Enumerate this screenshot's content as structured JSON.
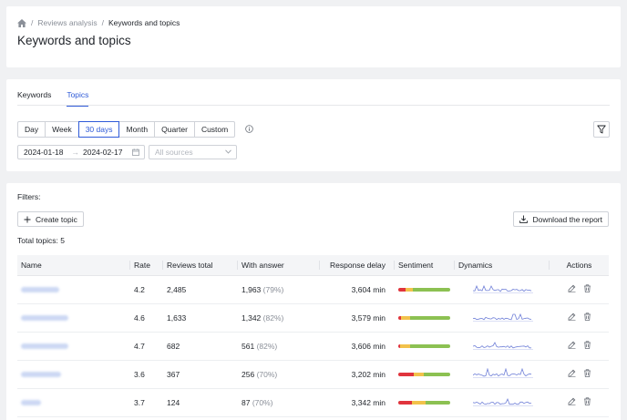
{
  "breadcrumb": {
    "section": "Reviews analysis",
    "current": "Keywords and topics"
  },
  "page_title": "Keywords and topics",
  "tabs": [
    {
      "label": "Keywords",
      "active": false
    },
    {
      "label": "Topics",
      "active": true
    }
  ],
  "period": {
    "options": [
      "Day",
      "Week",
      "30 days",
      "Month",
      "Quarter",
      "Custom"
    ],
    "selected": "30 days"
  },
  "daterange": {
    "from": "2024-01-18",
    "to": "2024-02-17",
    "separator": "→"
  },
  "sources": {
    "placeholder": "All sources"
  },
  "filters_label": "Filters:",
  "create_topic_label": "Create topic",
  "download_label": "Download the report",
  "total_topics": "Total topics: 5",
  "table": {
    "columns": {
      "name": "Name",
      "rate": "Rate",
      "reviews_total": "Reviews total",
      "with_answer": "With answer",
      "response_delay": "Response delay",
      "sentiment": "Sentiment",
      "dynamics": "Dynamics",
      "actions": "Actions"
    },
    "rows": [
      {
        "rate": "4.2",
        "reviews_total": "2,485",
        "with_answer": "1,963",
        "with_answer_pct": "(79%)",
        "response_delay": "3,604 min",
        "sentiment": [
          0.14,
          0.14,
          0.72
        ]
      },
      {
        "rate": "4.6",
        "reviews_total": "1,633",
        "with_answer": "1,342",
        "with_answer_pct": "(82%)",
        "response_delay": "3,579 min",
        "sentiment": [
          0.05,
          0.17,
          0.78
        ]
      },
      {
        "rate": "4.7",
        "reviews_total": "682",
        "with_answer": "561",
        "with_answer_pct": "(82%)",
        "response_delay": "3,606 min",
        "sentiment": [
          0.04,
          0.18,
          0.78
        ]
      },
      {
        "rate": "3.6",
        "reviews_total": "367",
        "with_answer": "256",
        "with_answer_pct": "(70%)",
        "response_delay": "3,202 min",
        "sentiment": [
          0.29,
          0.21,
          0.5
        ]
      },
      {
        "rate": "3.7",
        "reviews_total": "124",
        "with_answer": "87",
        "with_answer_pct": "(70%)",
        "response_delay": "3,342 min",
        "sentiment": [
          0.27,
          0.26,
          0.47
        ]
      }
    ]
  },
  "colors": {
    "accent": "#2f5bd8",
    "negative": "#e0343d",
    "neutral": "#f2c24b",
    "positive": "#8cc152",
    "sparkline": "#7080d8"
  },
  "icons": {
    "home": "home-icon",
    "info": "info-icon",
    "filter": "filter-icon",
    "calendar": "calendar-icon",
    "plus": "plus-icon",
    "download": "download-icon",
    "edit": "edit-icon",
    "delete": "trash-icon"
  }
}
